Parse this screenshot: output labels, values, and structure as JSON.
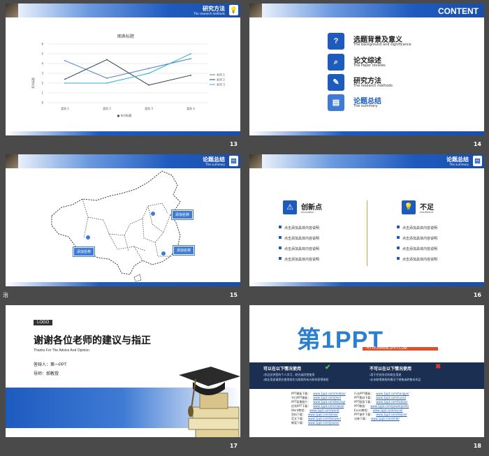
{
  "slides": {
    "s13": {
      "number": "13",
      "header_title": "研究方法",
      "header_sub": "The research methods",
      "chart_data": {
        "type": "line",
        "title": "图表标题",
        "ylabel": "系列标题",
        "xlabel": "",
        "categories": [
          "类别 1",
          "类别 2",
          "类别 3",
          "类别 4"
        ],
        "ylim": [
          0,
          6
        ],
        "yticks": [
          "0",
          "1",
          "2",
          "3",
          "4",
          "5",
          "6"
        ],
        "bottom_legend": "■ 系列标题",
        "series": [
          {
            "name": "系列 1",
            "values": [
              4.3,
              2.5,
              3.5,
              4.5
            ],
            "color": "#4f7fc7"
          },
          {
            "name": "系列 2",
            "values": [
              2.4,
              4.4,
              1.8,
              2.8
            ],
            "color": "#2e4057"
          },
          {
            "name": "系列 3",
            "values": [
              2.0,
              2.0,
              3.0,
              5.0
            ],
            "color": "#2bb0d8"
          }
        ]
      }
    },
    "s14": {
      "number": "14",
      "header_title": "CONTENT",
      "items": [
        {
          "title": "选题背景及意义",
          "sub": "The background and significance",
          "icon": "?"
        },
        {
          "title": "论文综述",
          "sub": "The Paper reviews",
          "icon": "⌕"
        },
        {
          "title": "研究方法",
          "sub": "The research methods",
          "icon": "✎"
        },
        {
          "title": "论题总结",
          "sub": "The summary",
          "icon": "▤"
        }
      ]
    },
    "s15": {
      "number": "15",
      "header_title": "论题总结",
      "header_sub": "The summary",
      "tags": [
        "添加名称",
        "添加名称",
        "添加名称"
      ],
      "left_mark": "治"
    },
    "s16": {
      "number": "16",
      "header_title": "论题总结",
      "header_sub": "The summary",
      "left": {
        "title": "创新点",
        "sub": "Innovation",
        "bullets": [
          "点击添加具体内容说明",
          "点击添加具体内容说明",
          "点击添加具体内容说明",
          "点击添加具体内容说明"
        ]
      },
      "right": {
        "title": "不足",
        "sub": "Insufficient",
        "bullets": [
          "点击添加具体内容说明",
          "点击添加具体内容说明",
          "点击添加具体内容说明",
          "点击添加具体内容说明"
        ]
      }
    },
    "s17": {
      "number": "17",
      "logo": "LOGO",
      "title": "谢谢各位老师的建议与指正",
      "subtitle": "Thanks For The Advice And Opinion",
      "speaker": "答辩人：第一PPT",
      "advisor": "导师：郝教授"
    },
    "s18": {
      "number": "18",
      "brand_main": "第1PPT",
      "brand_url": "HTTP://WWW.1PPT.COM",
      "can_title": "可以在以下情况使用",
      "can_lines": [
        "•作品仅供您的个人学习、研究或欣赏使用",
        "•商业用途请您在使用前先与版权所有方联系获得授权"
      ],
      "cannot_title": "不可以在以下情况使用",
      "cannot_lines": [
        "•用于任何形式的商业用途",
        "•在未取得授权的情况下销售或转售本作品"
      ],
      "links_left": [
        {
          "label": "PPT模板下载：",
          "url": "www.1ppt.com/moban/"
        },
        {
          "label": "节日PPT模板：",
          "url": "www.1ppt.com/jieri/"
        },
        {
          "label": "PPT背景图片：",
          "url": "www.1ppt.com/beijing/"
        },
        {
          "label": "优秀PPT下载：",
          "url": "www.1ppt.com/xiazai/"
        },
        {
          "label": "Word教程：",
          "url": "www.1ppt.com/word/"
        },
        {
          "label": "资料下载：",
          "url": "www.1ppt.com/ziliao/"
        },
        {
          "label": "范文下载：",
          "url": "www.1ppt.com/fanwen/"
        },
        {
          "label": "教案下载：",
          "url": "www.1ppt.com/jiaoan/"
        }
      ],
      "links_right": [
        {
          "label": "行业PPT模板：",
          "url": "www.1ppt.com/hangye/"
        },
        {
          "label": "PPT素材下载：",
          "url": "www.1ppt.com/sucai/"
        },
        {
          "label": "PPT图表下载：",
          "url": "www.1ppt.com/tubiao/"
        },
        {
          "label": "PPT教程：",
          "url": "www.1ppt.com/powerpoint/"
        },
        {
          "label": "Excel教程：",
          "url": "www.1ppt.com/excel/"
        },
        {
          "label": "PPT课件下载：",
          "url": "www.1ppt.com/kejian/"
        },
        {
          "label": "试卷下载：",
          "url": "www.1ppt.com/shiti/"
        }
      ]
    }
  }
}
